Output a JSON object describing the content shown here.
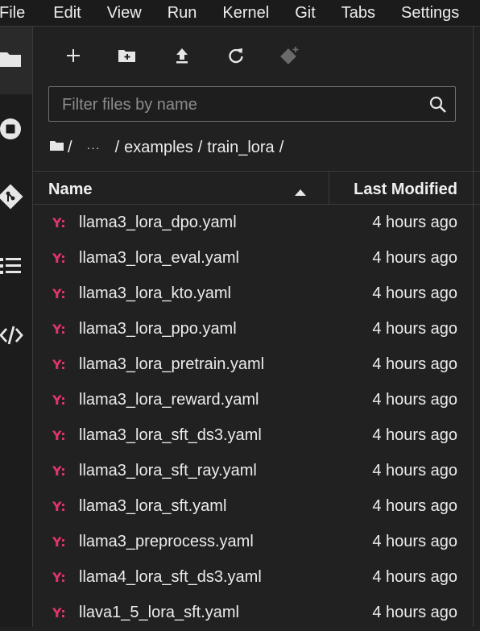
{
  "menubar": {
    "items": [
      "File",
      "Edit",
      "View",
      "Run",
      "Kernel",
      "Git",
      "Tabs",
      "Settings"
    ]
  },
  "activity_bar": {
    "icons": [
      "folder-icon",
      "stop-circle-icon",
      "git-icon",
      "list-icon",
      "code-icon"
    ]
  },
  "toolbar": {
    "icons": [
      "plus-icon",
      "new-folder-icon",
      "upload-icon",
      "refresh-icon",
      "git-clone-icon"
    ]
  },
  "filter": {
    "placeholder": "Filter files by name",
    "value": ""
  },
  "breadcrumb": {
    "root_sep": "/",
    "ellipsis": "···",
    "parts": [
      "examples",
      "train_lora"
    ],
    "separator": "/"
  },
  "file_list": {
    "col_name": "Name",
    "col_modified": "Last Modified",
    "sort": "ascending",
    "icon_glyph": "Y:",
    "icon_color": "#e0366b",
    "files": [
      {
        "name": "llama3_lora_dpo.yaml",
        "modified": "4 hours ago"
      },
      {
        "name": "llama3_lora_eval.yaml",
        "modified": "4 hours ago"
      },
      {
        "name": "llama3_lora_kto.yaml",
        "modified": "4 hours ago"
      },
      {
        "name": "llama3_lora_ppo.yaml",
        "modified": "4 hours ago"
      },
      {
        "name": "llama3_lora_pretrain.yaml",
        "modified": "4 hours ago"
      },
      {
        "name": "llama3_lora_reward.yaml",
        "modified": "4 hours ago"
      },
      {
        "name": "llama3_lora_sft_ds3.yaml",
        "modified": "4 hours ago"
      },
      {
        "name": "llama3_lora_sft_ray.yaml",
        "modified": "4 hours ago"
      },
      {
        "name": "llama3_lora_sft.yaml",
        "modified": "4 hours ago"
      },
      {
        "name": "llama3_preprocess.yaml",
        "modified": "4 hours ago"
      },
      {
        "name": "llama4_lora_sft_ds3.yaml",
        "modified": "4 hours ago"
      },
      {
        "name": "llava1_5_lora_sft.yaml",
        "modified": "4 hours ago"
      }
    ]
  }
}
